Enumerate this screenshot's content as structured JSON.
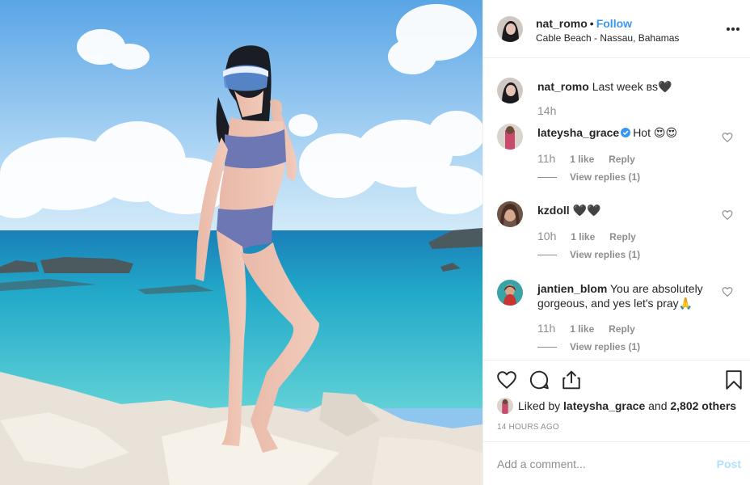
{
  "post": {
    "username": "nat_romo",
    "separator": "•",
    "follow_label": "Follow",
    "location": "Cable Beach - Nassau, Bahamas",
    "more_icon": "more-horizontal-icon"
  },
  "caption": {
    "username": "nat_romo",
    "text": "Last week ʙs🖤",
    "time": "14h"
  },
  "comments": [
    {
      "username": "lateysha_grace",
      "verified": true,
      "text": "Hot 😍😍",
      "time": "11h",
      "likes": "1 like",
      "reply": "Reply",
      "view_replies": "View replies (1)"
    },
    {
      "username": "kzdoll",
      "verified": false,
      "text": "🖤🖤",
      "time": "10h",
      "likes": "1 like",
      "reply": "Reply",
      "view_replies": "View replies (1)"
    },
    {
      "username": "jantien_blom",
      "verified": false,
      "text": "You are absolutely gorgeous, and yes let's pray🙏",
      "time": "11h",
      "likes": "1 like",
      "reply": "Reply",
      "view_replies": "View replies (1)"
    }
  ],
  "likes": {
    "prefix": "Liked by",
    "user": "lateysha_grace",
    "middle": "and",
    "others": "2,802 others"
  },
  "timestamp": "14 HOURS AGO",
  "add_comment": {
    "placeholder": "Add a comment...",
    "post_label": "Post"
  },
  "colors": {
    "accent": "#3897f0",
    "post_disabled": "#b2dffc",
    "muted": "#8e8e8e",
    "verified": "#3897f0"
  }
}
